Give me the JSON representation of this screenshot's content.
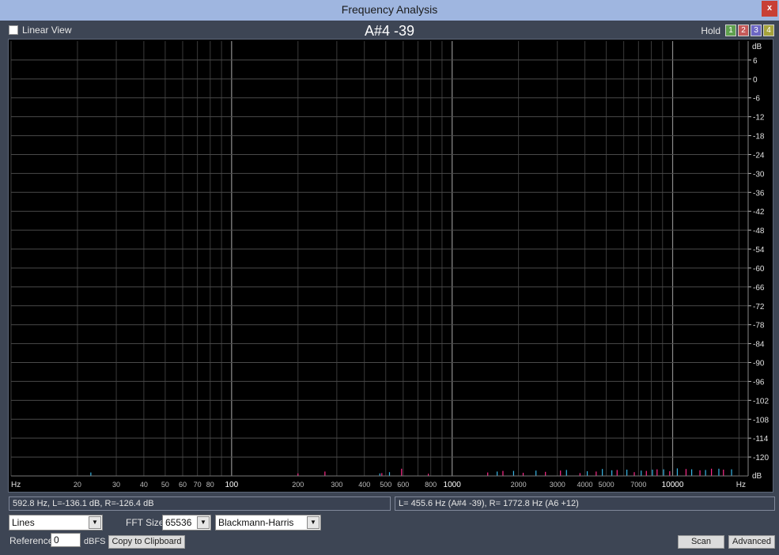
{
  "window": {
    "title": "Frequency Analysis",
    "close_label": "x"
  },
  "toolbar": {
    "linear_view_label": "Linear View",
    "linear_view_checked": false,
    "note_readout": "A#4 -39",
    "hold_label": "Hold",
    "hold_buttons": [
      {
        "label": "1",
        "color": "#5fa04e"
      },
      {
        "label": "2",
        "color": "#c55a5a"
      },
      {
        "label": "3",
        "color": "#6d67c4"
      },
      {
        "label": "4",
        "color": "#a6a33c"
      }
    ]
  },
  "chart_data": {
    "type": "line",
    "xscale": "log",
    "xlim": [
      10,
      22000
    ],
    "ylim": [
      -126,
      12
    ],
    "xlabel": "Hz",
    "ylabel": "dB",
    "x_ticks": [
      "20",
      "30",
      "40",
      "50",
      "60",
      "70",
      "80",
      "100",
      "200",
      "300",
      "400",
      "500",
      "600",
      "800",
      "1000",
      "2000",
      "3000",
      "4000",
      "5000",
      "7000",
      "10000"
    ],
    "x_tick_values": [
      20,
      30,
      40,
      50,
      60,
      70,
      80,
      100,
      200,
      300,
      400,
      500,
      600,
      800,
      1000,
      2000,
      3000,
      4000,
      5000,
      7000,
      10000
    ],
    "y_ticks": [
      "6",
      "0",
      "-6",
      "-12",
      "-18",
      "-24",
      "-30",
      "-36",
      "-42",
      "-48",
      "-54",
      "-60",
      "-66",
      "-72",
      "-78",
      "-84",
      "-90",
      "-96",
      "-102",
      "-108",
      "-114",
      "-120"
    ],
    "y_tick_values": [
      6,
      0,
      -6,
      -12,
      -18,
      -24,
      -30,
      -36,
      -42,
      -48,
      -54,
      -60,
      -66,
      -72,
      -78,
      -84,
      -90,
      -96,
      -102,
      -108,
      -114,
      -120
    ],
    "series": [
      {
        "color": "#ff2a8a",
        "x": [
          200,
          265,
          480,
          590,
          780,
          1450,
          1700,
          2100,
          2650,
          3100,
          3800,
          4500,
          5600,
          6700,
          7600,
          8500,
          9700,
          11500,
          13300,
          15000,
          17000
        ],
        "y": [
          -125.2,
          -124.6,
          -125.1,
          -123.7,
          -125.3,
          -124.9,
          -124.4,
          -125.0,
          -124.7,
          -124.3,
          -125.1,
          -124.6,
          -124.1,
          -124.8,
          -124.4,
          -123.9,
          -124.5,
          -123.8,
          -124.2,
          -123.7,
          -124.0
        ]
      },
      {
        "color": "#38b7e8",
        "x": [
          23,
          470,
          520,
          1600,
          1900,
          2400,
          3300,
          4100,
          4800,
          5300,
          6200,
          7200,
          8100,
          9100,
          10500,
          12200,
          14100,
          16200,
          18500
        ],
        "y": [
          -124.9,
          -125.2,
          -124.8,
          -124.6,
          -124.4,
          -124.3,
          -124.1,
          -124.5,
          -123.8,
          -124.2,
          -124.0,
          -124.3,
          -124.0,
          -123.9,
          -123.6,
          -123.9,
          -124.1,
          -123.7,
          -123.9
        ]
      }
    ]
  },
  "status": {
    "cursor_readout": "592.8 Hz, L=-136.1 dB, R=-126.4 dB",
    "peak_readout": "L=  455.6 Hz (A#4 -39), R= 1772.8 Hz (A6 +12)"
  },
  "controls": {
    "display_mode": "Lines",
    "fft_size_label": "FFT Size",
    "fft_size": "65536",
    "window_function": "Blackmann-Harris",
    "reference_label": "Reference",
    "reference_value": "0",
    "reference_unit": "dBFS",
    "copy_button": "Copy to Clipboard",
    "scan_button": "Scan",
    "advanced_button": "Advanced"
  }
}
